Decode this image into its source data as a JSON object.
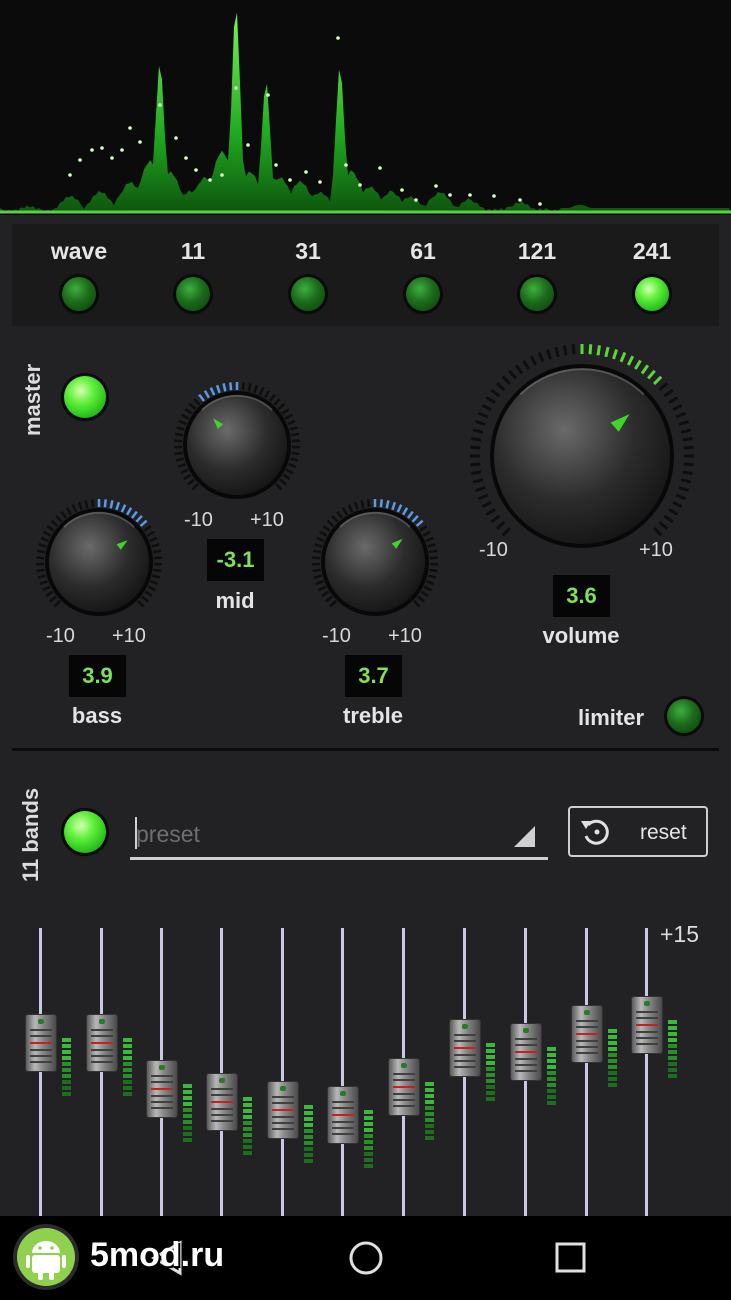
{
  "spectrum": {
    "accent_color": "#39e639"
  },
  "modes": {
    "items": [
      {
        "label": "wave",
        "active": false
      },
      {
        "label": "11",
        "active": false
      },
      {
        "label": "31",
        "active": false
      },
      {
        "label": "61",
        "active": false
      },
      {
        "label": "121",
        "active": false
      },
      {
        "label": "241",
        "active": true
      }
    ]
  },
  "master": {
    "label": "master",
    "enabled": true
  },
  "knobs": {
    "mid": {
      "label": "mid",
      "value": "-3.1",
      "min": "-10",
      "max": "+10"
    },
    "bass": {
      "label": "bass",
      "value": "3.9",
      "min": "-10",
      "max": "+10"
    },
    "treble": {
      "label": "treble",
      "value": "3.7",
      "min": "-10",
      "max": "+10"
    },
    "volume": {
      "label": "volume",
      "value": "3.6",
      "min": "-10",
      "max": "+10"
    }
  },
  "limiter": {
    "label": "limiter",
    "enabled": false
  },
  "bands": {
    "label": "11 bands",
    "enabled": true,
    "preset_placeholder": "preset",
    "reset_label": "reset",
    "max_label": "+15",
    "levels": [
      4.2,
      4.2,
      -5.4,
      -8.2,
      -9.8,
      -10.8,
      -5.0,
      3.2,
      2.2,
      6.0,
      8.0
    ]
  },
  "watermark": {
    "text": "5mod.ru"
  },
  "navigation": {
    "icons": [
      "back-icon",
      "home-icon",
      "recents-icon"
    ]
  },
  "colors": {
    "accent": "#5ef03a",
    "value_text": "#7fe05a",
    "background": "#222224"
  }
}
